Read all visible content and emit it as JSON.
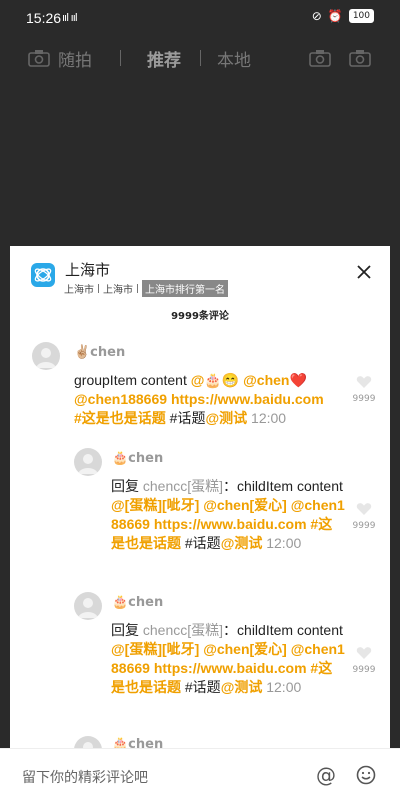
{
  "status": {
    "time": "15:26",
    "signal": "ııl ııl",
    "battery": "100"
  },
  "topnav": {
    "tabs": [
      {
        "label": "随拍"
      },
      {
        "label": "推荐"
      },
      {
        "label": "本地"
      }
    ]
  },
  "sheet": {
    "location_title": "上海市",
    "location_sub": [
      "上海市",
      "上海市"
    ],
    "rank_badge": "上海市排行第一名",
    "comment_count": "9999条评论",
    "comments": [
      {
        "name": "✌🏼chen",
        "body_plain_1": "groupItem content ",
        "emoji": "@🎂😁 ",
        "mention1": "@chen❤️",
        "mention2": "@chen188669",
        "link": "https://www.baidu.com",
        "topic1": "#这是也是话题",
        "topic2": " #话题",
        "mention3": "@测试",
        "time": "12:00",
        "likes": "9999"
      },
      {
        "name": "🎂chen",
        "reply": "回复 ",
        "reply_to": "chencc[蛋糕]",
        "sep": "：childItem content ",
        "emo": "@[蛋糕][呲牙] @chen[爱心] @chen188669 ",
        "link": "https://www.baidu.com",
        "topic1": " #这是也是话题",
        "topic2": " #话题",
        "mention3": "@测试",
        "time": "12:00",
        "likes": "9999"
      },
      {
        "name": "🎂chen",
        "reply": "回复 ",
        "reply_to": "chencc[蛋糕]",
        "sep": "：childItem content ",
        "emo": "@[蛋糕][呲牙] @chen[爱心] @chen188669 ",
        "link": "https://www.baidu.com",
        "topic1": " #这是也是话题",
        "topic2": " #话题",
        "mention3": "@测试",
        "time": "12:00",
        "likes": "9999"
      },
      {
        "name": "🎂chen"
      }
    ]
  },
  "bottom": {
    "placeholder": "留下你的精彩评论吧",
    "at": "@"
  }
}
